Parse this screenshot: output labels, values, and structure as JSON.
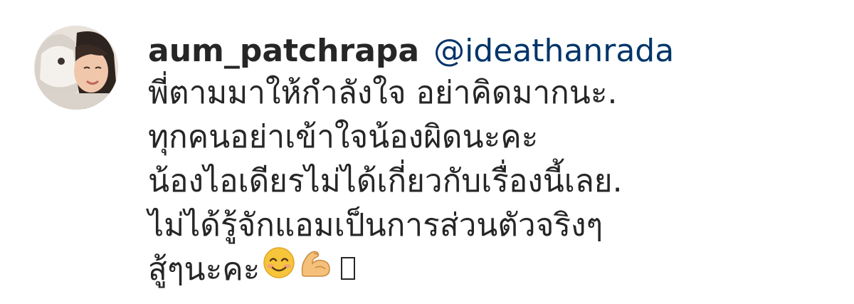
{
  "comment": {
    "username": "aum_patchrapa",
    "mention": "@ideathanrada",
    "lines": [
      "พี่ตามมาให้กำลังใจ อย่าคิดมากนะ.",
      "ทุกคนอย่าเข้าใจน้องผิดนะคะ",
      "น้องไอเดียรไม่ได้เกี่ยวกับเรื่องนี้เลย.",
      "ไม่ได้รู้จักแอมเป็นการส่วนตัวจริงๆ",
      "สู้ๆนะคะ"
    ],
    "emojis": [
      "smiling-face-icon",
      "flexed-biceps-icon",
      "missing-glyph-box"
    ]
  },
  "colors": {
    "text": "#262626",
    "mention": "#003569",
    "background": "#ffffff"
  }
}
